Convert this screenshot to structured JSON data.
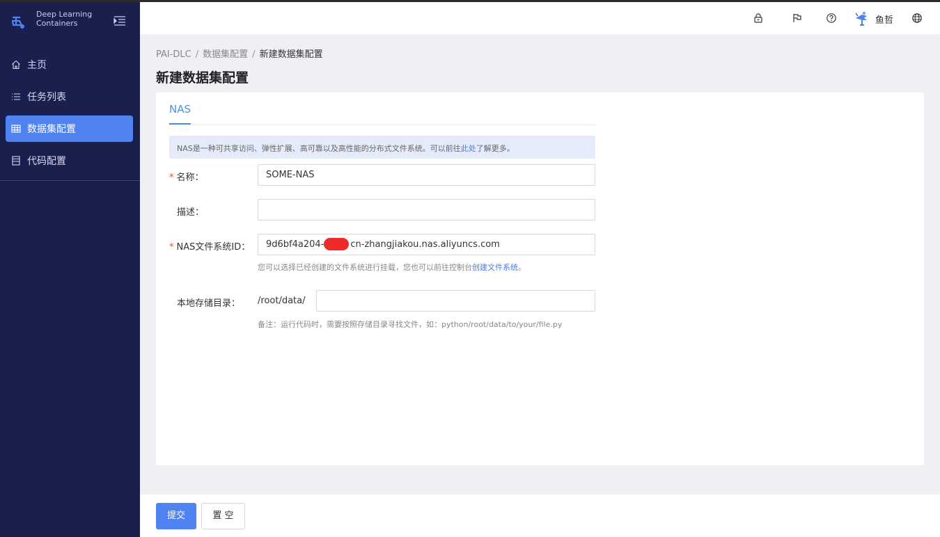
{
  "app": {
    "brand_line1": "Deep Learning",
    "brand_line2": "Containers"
  },
  "sidebar": {
    "items": [
      {
        "label": "主页",
        "icon": "home-icon"
      },
      {
        "label": "任务列表",
        "icon": "list-icon"
      },
      {
        "label": "数据集配置",
        "icon": "table-icon",
        "active": true
      },
      {
        "label": "代码配置",
        "icon": "document-icon"
      }
    ]
  },
  "header": {
    "icons": [
      "lock-icon",
      "flag-icon",
      "help-icon",
      "avatar",
      "globe-icon"
    ],
    "user_name": "鱼哲"
  },
  "breadcrumb": {
    "items": [
      "PAI-DLC",
      "数据集配置",
      "新建数据集配置"
    ]
  },
  "page": {
    "title": "新建数据集配置"
  },
  "tabs": {
    "active": "NAS"
  },
  "notice": {
    "text_before": "NAS是一种可共享访问、弹性扩展、高可靠以及高性能的分布式文件系统。可以前往",
    "link": "此处",
    "text_after": "了解更多。"
  },
  "form": {
    "name": {
      "label": "名称：",
      "value": "SOME-NAS",
      "required": true
    },
    "description": {
      "label": "描述：",
      "value": ""
    },
    "nas_id": {
      "label": "NAS文件系统ID：",
      "value_before_redaction": "9d6bf4a204-",
      "value_after_redaction": "cn-zhangjiakou.nas.aliyuncs.com",
      "required": true,
      "help_before": "您可以选择已经创建的文件系统进行挂载，您也可以前往控制台",
      "help_link": "创建文件系统",
      "help_after": "。"
    },
    "local_dir": {
      "label": "本地存储目录：",
      "prefix": "/root/data/",
      "value": "",
      "help": "备注：运行代码时，需要按照存储目录寻找文件，如：python/root/data/to/your/file.py"
    }
  },
  "footer": {
    "submit_label": "提交",
    "reset_label": "置 空"
  },
  "colors": {
    "sidebar_bg": "#1b1f4d",
    "accent": "#4f83f0",
    "required": "#f04b3b",
    "redaction": "#ee2b2b"
  }
}
